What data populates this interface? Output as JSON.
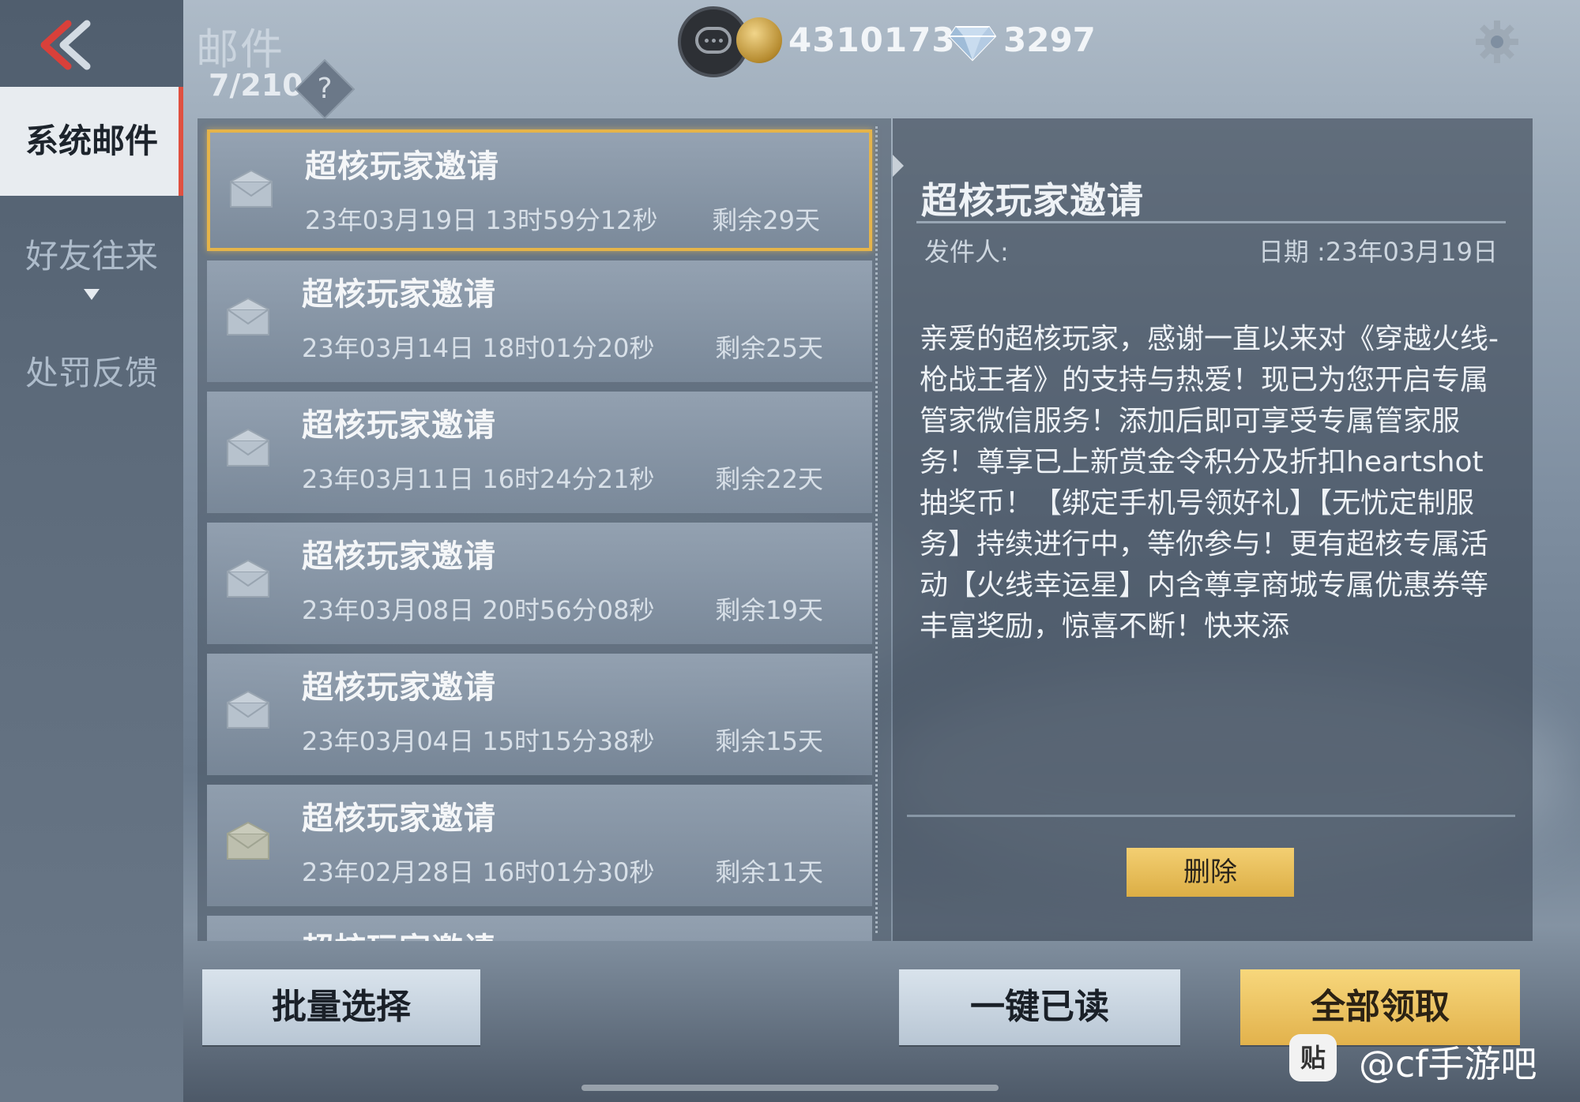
{
  "header": {
    "title": "邮件",
    "count": "7/210",
    "help_label": "?",
    "coins": "4310173",
    "diamonds": "3297"
  },
  "sidebar": {
    "items": [
      {
        "label": "系统邮件",
        "active": true
      },
      {
        "label": "好友往来",
        "active": false
      },
      {
        "label": "处罚反馈",
        "active": false
      }
    ]
  },
  "mail_list": [
    {
      "title": "超核玩家邀请",
      "date": "23年03月19日 13时59分12秒",
      "remaining": "剩余29天"
    },
    {
      "title": "超核玩家邀请",
      "date": "23年03月14日 18时01分20秒",
      "remaining": "剩余25天"
    },
    {
      "title": "超核玩家邀请",
      "date": "23年03月11日 16时24分21秒",
      "remaining": "剩余22天"
    },
    {
      "title": "超核玩家邀请",
      "date": "23年03月08日 20时56分08秒",
      "remaining": "剩余19天"
    },
    {
      "title": "超核玩家邀请",
      "date": "23年03月04日 15时15分38秒",
      "remaining": "剩余15天"
    },
    {
      "title": "超核玩家邀请",
      "date": "23年02月28日 16时01分30秒",
      "remaining": "剩余11天"
    },
    {
      "title": "超核玩家邀请",
      "date": "",
      "remaining": ""
    }
  ],
  "detail": {
    "title": "超核玩家邀请",
    "sender_label": "发件人:",
    "date_label": "日期 :23年03月19日",
    "body": "亲爱的超核玩家，感谢一直以来对《穿越火线-枪战王者》的支持与热爱！现已为您开启专属管家微信服务！添加后即可享受专属管家服务！尊享已上新赏金令积分及折扣heartshot抽奖币！【绑定手机号领好礼】【无忧定制服务】持续进行中，等你参与！更有超核专属活动【火线幸运星】内含尊享商城专属优惠券等丰富奖励，惊喜不断！快来添",
    "delete_label": "删除"
  },
  "actions": {
    "batch_select": "批量选择",
    "mark_all_read": "一键已读",
    "claim_all": "全部领取"
  },
  "watermark": {
    "logo": "贴",
    "text": "@cf手游吧"
  },
  "colors": {
    "accent_gold": "#e5b44a",
    "active_tab_marker": "#e05040"
  }
}
